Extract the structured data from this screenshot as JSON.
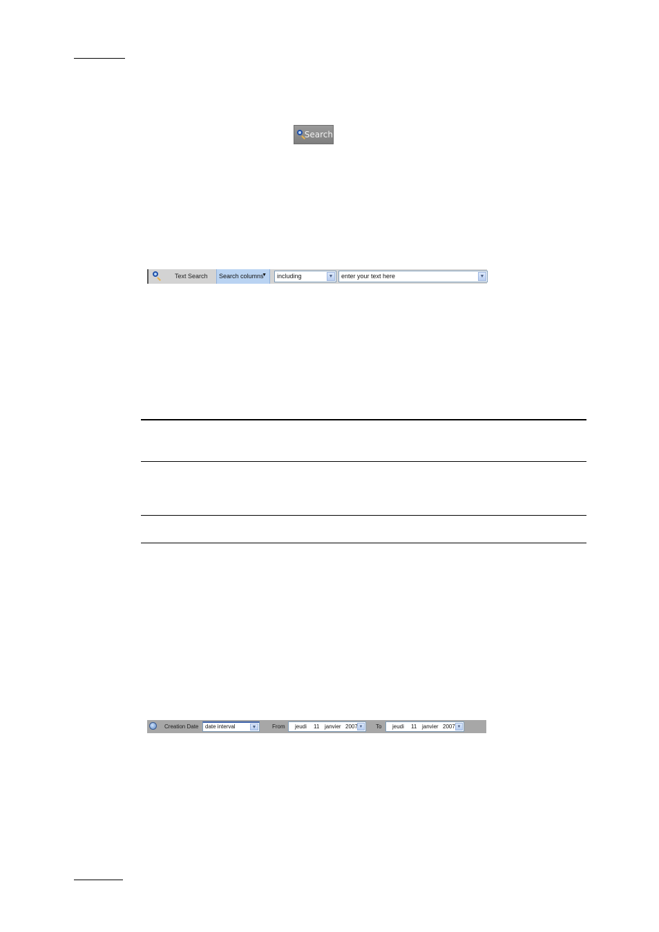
{
  "search_button": {
    "label": "Search",
    "icon": "magnifier-icon"
  },
  "text_search_bar": {
    "label": "Text Search",
    "columns_button": "Search columns",
    "columns_arrow": "▼",
    "operator_select": {
      "value": "including"
    },
    "text_input": {
      "placeholder": "enter your text here"
    },
    "icon": "magnifier-icon",
    "accent_color": "#b9d3f2"
  },
  "date_filter_bar": {
    "icon": "clock-icon",
    "label": "Creation Date",
    "interval_select": {
      "value": "date interval"
    },
    "from_label": "From",
    "to_label": "To",
    "from_date": {
      "weekday": "jeudi",
      "day": "11",
      "month": "janvier",
      "year": "2007"
    },
    "to_date": {
      "weekday": "jeudi",
      "day": "11",
      "month": "janvier",
      "year": "2007"
    }
  }
}
